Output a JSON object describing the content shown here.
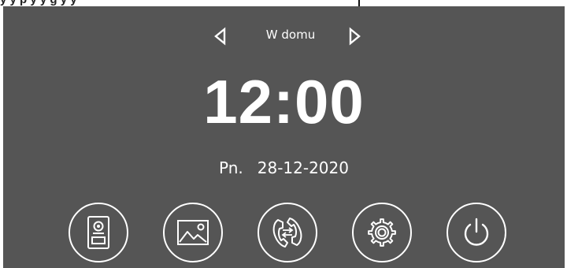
{
  "caption": {
    "text": "y y p y y g y y"
  },
  "mode_selector": {
    "label": "W domu",
    "prev_icon": "triangle-left-outline",
    "next_icon": "triangle-right-outline"
  },
  "clock": {
    "time": "12:00"
  },
  "date": {
    "day": "Pn.",
    "value": "28-12-2020"
  },
  "menu": [
    {
      "name": "door-station-button",
      "icon": "door-station-icon"
    },
    {
      "name": "gallery-button",
      "icon": "gallery-icon"
    },
    {
      "name": "intercom-button",
      "icon": "intercom-call-icon"
    },
    {
      "name": "settings-button",
      "icon": "gear-icon"
    },
    {
      "name": "power-button",
      "icon": "power-icon"
    }
  ],
  "colors": {
    "screen_background": "#555555",
    "foreground": "#ffffff"
  }
}
